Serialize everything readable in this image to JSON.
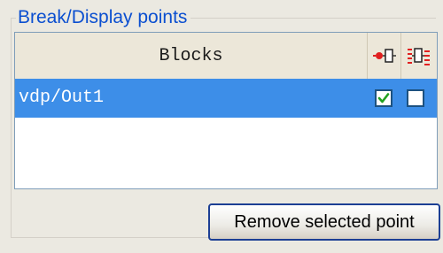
{
  "group": {
    "title": "Break/Display points"
  },
  "table": {
    "columns": [
      {
        "label": "Blocks"
      },
      {
        "icon": "breakpoint-icon"
      },
      {
        "icon": "display-point-icon"
      }
    ],
    "rows": [
      {
        "name": "vdp/Out1",
        "selected": true,
        "breakpoint": true,
        "display": false
      }
    ]
  },
  "button": {
    "label": "Remove selected point"
  },
  "colors": {
    "accent": "#0b4fd0",
    "selection": "#3d8ee8",
    "check": "#21a121"
  }
}
